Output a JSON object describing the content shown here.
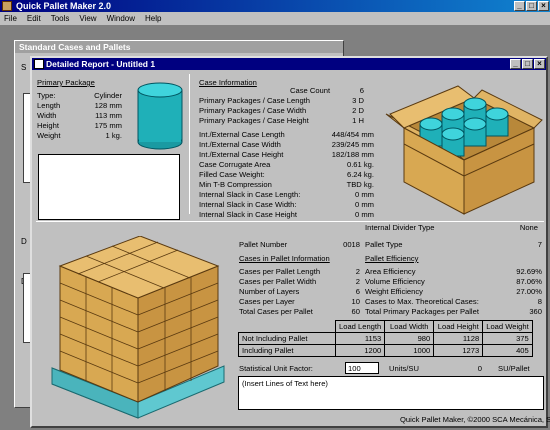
{
  "app": {
    "title": "Quick Pallet Maker 2.0",
    "menu": [
      "File",
      "Edit",
      "Tools",
      "View",
      "Window",
      "Help"
    ]
  },
  "background_window": {
    "title": "Standard Cases and Pallets",
    "fragments": [
      "S",
      "D",
      "D",
      "S",
      "E",
      "E",
      "C"
    ]
  },
  "report": {
    "title": "Detailed Report - Untitled 1",
    "primary_package": {
      "heading": "Primary Package",
      "rows": [
        {
          "label": "Type:",
          "value": "Cylinder"
        },
        {
          "label": "Length",
          "value": "128 mm"
        },
        {
          "label": "Width",
          "value": "113 mm"
        },
        {
          "label": "Height",
          "value": "175 mm"
        },
        {
          "label": "Weight",
          "value": "1 kg."
        }
      ]
    },
    "case_info": {
      "heading": "Case Information",
      "case_count_label": "Case Count",
      "case_count": "6",
      "rows": [
        {
          "label": "Primary Packages / Case Length",
          "value": "3 D"
        },
        {
          "label": "Primary Packages / Case Width",
          "value": "2 D"
        },
        {
          "label": "Primary Packages / Case Height",
          "value": "1 H"
        }
      ],
      "dims": [
        {
          "label": "Int./External Case Length",
          "value": "448/454 mm"
        },
        {
          "label": "Int./External Case Width",
          "value": "239/245 mm"
        },
        {
          "label": "Int./External Case Height",
          "value": "182/188 mm"
        },
        {
          "label": "Case Corrugate Area",
          "value": "0.61 kg."
        },
        {
          "label": "Filled Case Weight:",
          "value": "6.24 kg."
        },
        {
          "label": "Min T-B Compression",
          "value": "TBD kg."
        },
        {
          "label": "Internal Slack in Case Length:",
          "value": "0 mm"
        },
        {
          "label": "Internal Slack in Case Width:",
          "value": "0 mm"
        },
        {
          "label": "Internal Slack in Case Height",
          "value": "0 mm"
        }
      ],
      "divider_label": "Internal Divider Type",
      "divider_value": "None"
    },
    "pallet": {
      "number_label": "Pallet Number",
      "number": "0018",
      "type_label": "Pallet Type",
      "type": "7",
      "cases_heading": "Cases in Pallet Information",
      "eff_heading": "Pallet Efficiency",
      "cases": [
        {
          "label": "Cases per Pallet Length",
          "value": "2"
        },
        {
          "label": "Cases per Pallet Width",
          "value": "2"
        },
        {
          "label": "Number of Layers",
          "value": "6"
        },
        {
          "label": "Cases per Layer",
          "value": "10"
        },
        {
          "label": "Total Cases per Pallet",
          "value": "60"
        }
      ],
      "efficiency": [
        {
          "label": "Area Efficiency",
          "value": "92.69%"
        },
        {
          "label": "Volume Efficiency",
          "value": "87.06%"
        },
        {
          "label": "Weight Efficiency",
          "value": "27.00%"
        },
        {
          "label": "Cases to Max. Theoretical Cases:",
          "value": "8"
        },
        {
          "label": "Total Primary Packages per Pallet",
          "value": "360"
        }
      ]
    },
    "load_table": {
      "headers": [
        "Load Length",
        "Load Width",
        "Load Height",
        "Load Weight"
      ],
      "rows": [
        {
          "label": "Not Including Pallet",
          "values": [
            "1153",
            "980",
            "1128",
            "375"
          ]
        },
        {
          "label": "Including Pallet",
          "values": [
            "1200",
            "1000",
            "1273",
            "405"
          ]
        }
      ]
    },
    "su": {
      "label": "Statistical Unit Factor:",
      "value": "100",
      "units": "Units/SU",
      "result": "0",
      "result_units": "SU/Pallet"
    },
    "notes_placeholder": "(Insert Lines of Text here)",
    "footer": "Quick Pallet Maker, ©2000 SCA Mecánica, S.A."
  },
  "colors": {
    "title_active": "#000080",
    "cylinder": "#1fb0b8",
    "box": "#d8a852",
    "pallet": "#5fc8d0"
  }
}
